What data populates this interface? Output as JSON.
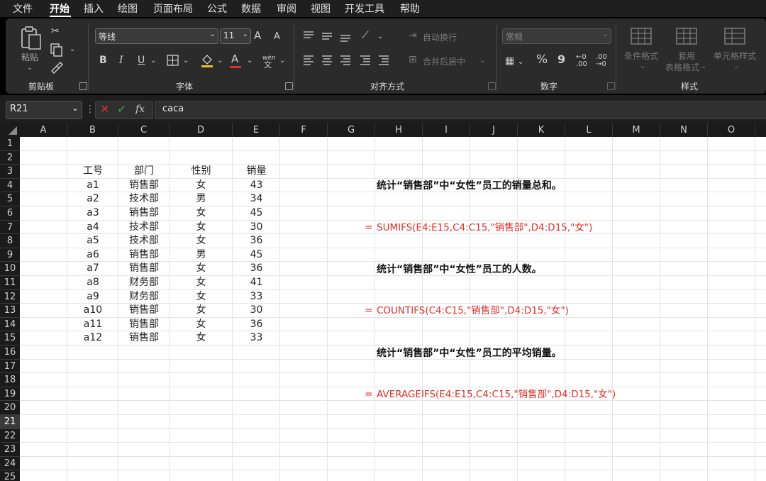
{
  "menu": {
    "items": [
      "文件",
      "开始",
      "插入",
      "绘图",
      "页面布局",
      "公式",
      "数据",
      "审阅",
      "视图",
      "开发工具",
      "帮助"
    ],
    "active": "开始"
  },
  "ribbon": {
    "clipboard": {
      "label": "剪贴板",
      "paste": "粘贴"
    },
    "font": {
      "label": "字体",
      "font_name": "等线",
      "font_size": "11",
      "bold": "B",
      "italic": "I",
      "underline": "U",
      "grow": "A",
      "shrink": "A",
      "phonetic": "wén"
    },
    "alignment": {
      "label": "对齐方式",
      "wrap_text": "自动换行",
      "merge_center": "合并后居中"
    },
    "number": {
      "label": "数字",
      "format": "常规",
      "percent": "%",
      "comma": "9"
    },
    "styles": {
      "label": "样式",
      "conditional": "条件格式",
      "table_format_1": "套用",
      "table_format_2": "表格格式",
      "cell_styles": "单元格样式"
    }
  },
  "formula_bar": {
    "name_box": "R21",
    "fx": "fx",
    "content": "caca"
  },
  "columns": [
    "A",
    "B",
    "C",
    "D",
    "E",
    "F",
    "G",
    "H",
    "I",
    "J",
    "K",
    "L",
    "M",
    "N",
    "O"
  ],
  "rows": [
    "1",
    "2",
    "3",
    "4",
    "5",
    "6",
    "7",
    "8",
    "9",
    "10",
    "11",
    "12",
    "13",
    "14",
    "15",
    "16",
    "17",
    "18",
    "19",
    "20",
    "21",
    "22",
    "23",
    "24",
    "25"
  ],
  "selected_row": "21",
  "table": {
    "headers": [
      "工号",
      "部门",
      "性别",
      "销量"
    ],
    "rows": [
      [
        "a1",
        "销售部",
        "女",
        "43"
      ],
      [
        "a2",
        "技术部",
        "男",
        "34"
      ],
      [
        "a3",
        "销售部",
        "女",
        "45"
      ],
      [
        "a4",
        "技术部",
        "女",
        "30"
      ],
      [
        "a5",
        "技术部",
        "女",
        "36"
      ],
      [
        "a6",
        "销售部",
        "男",
        "45"
      ],
      [
        "a7",
        "销售部",
        "女",
        "36"
      ],
      [
        "a8",
        "财务部",
        "女",
        "41"
      ],
      [
        "a9",
        "财务部",
        "女",
        "33"
      ],
      [
        "a10",
        "销售部",
        "女",
        "30"
      ],
      [
        "a11",
        "销售部",
        "女",
        "36"
      ],
      [
        "a12",
        "销售部",
        "女",
        "33"
      ]
    ]
  },
  "tasks": [
    {
      "question": "统计“销售部”中“女性”员工的销量总和。",
      "eq": "=",
      "formula": "SUMIFS(E4:E15,C4:C15,\"销售部\",D4:D15,\"女\")"
    },
    {
      "question": "统计“销售部”中“女性”员工的人数。",
      "eq": "=",
      "formula": "COUNTIFS(C4:C15,\"销售部\",D4:D15,\"女\")"
    },
    {
      "question": "统计“销售部”中“女性”员工的平均销量。",
      "eq": "=",
      "formula": "AVERAGEIFS(E4:E15,C4:C15,\"销售部\",D4:D15,\"女\")"
    }
  ]
}
